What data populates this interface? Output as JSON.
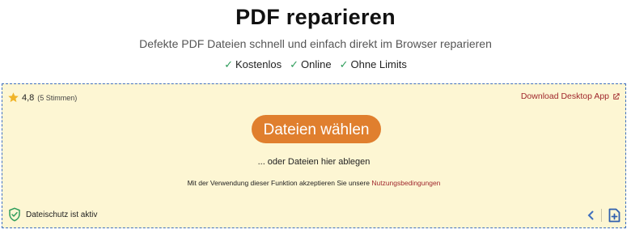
{
  "header": {
    "title": "PDF reparieren",
    "subtitle": "Defekte PDF Dateien schnell und einfach direkt im Browser reparieren",
    "features": [
      {
        "check": "✓",
        "label": "Kostenlos"
      },
      {
        "check": "✓",
        "label": "Online"
      },
      {
        "check": "✓",
        "label": "Ohne Limits"
      }
    ]
  },
  "dropzone": {
    "rating": {
      "score": "4,8",
      "votes": "(5 Stimmen)",
      "icon": "star-icon"
    },
    "download_label": "Download Desktop App",
    "download_icon": "external-link-icon",
    "choose_button": "Dateien wählen",
    "drop_hint": "... oder Dateien hier ablegen",
    "terms_text": "Mit der Verwendung dieser Funktion akzeptieren Sie unsere",
    "terms_link": "Nutzungsbedingungen",
    "protection_label": "Dateischutz ist aktiv",
    "protection_icon": "shield-check-icon",
    "collapse_icon": "chevron-left-icon",
    "add_file_icon": "add-file-icon"
  },
  "colors": {
    "accent_button": "#e07f2e",
    "dropzone_bg": "#fdf6d3",
    "dropzone_border": "#3f6fbe",
    "link": "#a0282d",
    "check": "#2e9d5b",
    "star": "#f0b429"
  }
}
